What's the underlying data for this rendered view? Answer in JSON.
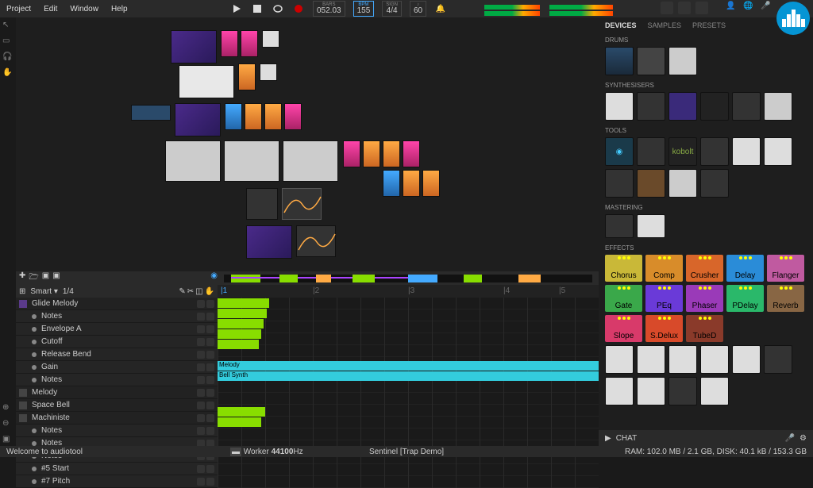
{
  "menu": {
    "project": "Project",
    "edit": "Edit",
    "window": "Window",
    "help": "Help"
  },
  "transport": {
    "bars_label": "BARS",
    "bars": "052.03",
    "bpm_label": "BPM",
    "bpm": "155",
    "sign_label": "SIGN",
    "sign": "4/4",
    "metro_label": "♪",
    "metro": "60"
  },
  "tabs": {
    "devices": "DEVICES",
    "samples": "SAMPLES",
    "presets": "PRESETS"
  },
  "sections": {
    "drums": "DRUMS",
    "synths": "SYNTHESISERS",
    "tools": "TOOLS",
    "mastering": "MASTERING",
    "effects": "EFFECTS"
  },
  "tools_labels": {
    "kobolt": "kobolt"
  },
  "effects": [
    {
      "n": "Chorus",
      "c": "#c9b838"
    },
    {
      "n": "Comp",
      "c": "#d88c2a"
    },
    {
      "n": "Crusher",
      "c": "#d8662a"
    },
    {
      "n": "Delay",
      "c": "#2a8cd8"
    },
    {
      "n": "Flanger",
      "c": "#c05aa0"
    },
    {
      "n": "Gate",
      "c": "#3aa84a"
    },
    {
      "n": "PEq",
      "c": "#6a3ad8"
    },
    {
      "n": "Phaser",
      "c": "#9a3ab8"
    },
    {
      "n": "PDelay",
      "c": "#2ab86a"
    },
    {
      "n": "Reverb",
      "c": "#886644"
    },
    {
      "n": "Slope",
      "c": "#d83a6a"
    },
    {
      "n": "S.Delux",
      "c": "#d84a2a"
    },
    {
      "n": "TubeD",
      "c": "#8a3a2a"
    }
  ],
  "timeline": {
    "smart": "Smart ▾",
    "snap": "1/4",
    "main_track": "Glide Melody",
    "sub": [
      "Notes",
      "Envelope A",
      "Cutoff",
      "Release Bend",
      "Gain",
      "Notes"
    ],
    "tracks": [
      "Melody",
      "Space Bell",
      "Machiniste"
    ],
    "sub2": [
      "Notes",
      "Notes",
      "Notes",
      "#5 Start",
      "#7 Pitch"
    ],
    "clips": {
      "melody": "Melody",
      "bell": "Bell Synth"
    }
  },
  "chat": "CHAT",
  "status": {
    "welcome": "Welcome to audiotool",
    "worker": "Worker",
    "hz": "44100",
    "hzu": "Hz",
    "project": "Sentinel [Trap Demo]",
    "ram": "RAM: 102.0 MB / 2.1 GB, DISK: 40.1 kB / 153.3 GB"
  }
}
